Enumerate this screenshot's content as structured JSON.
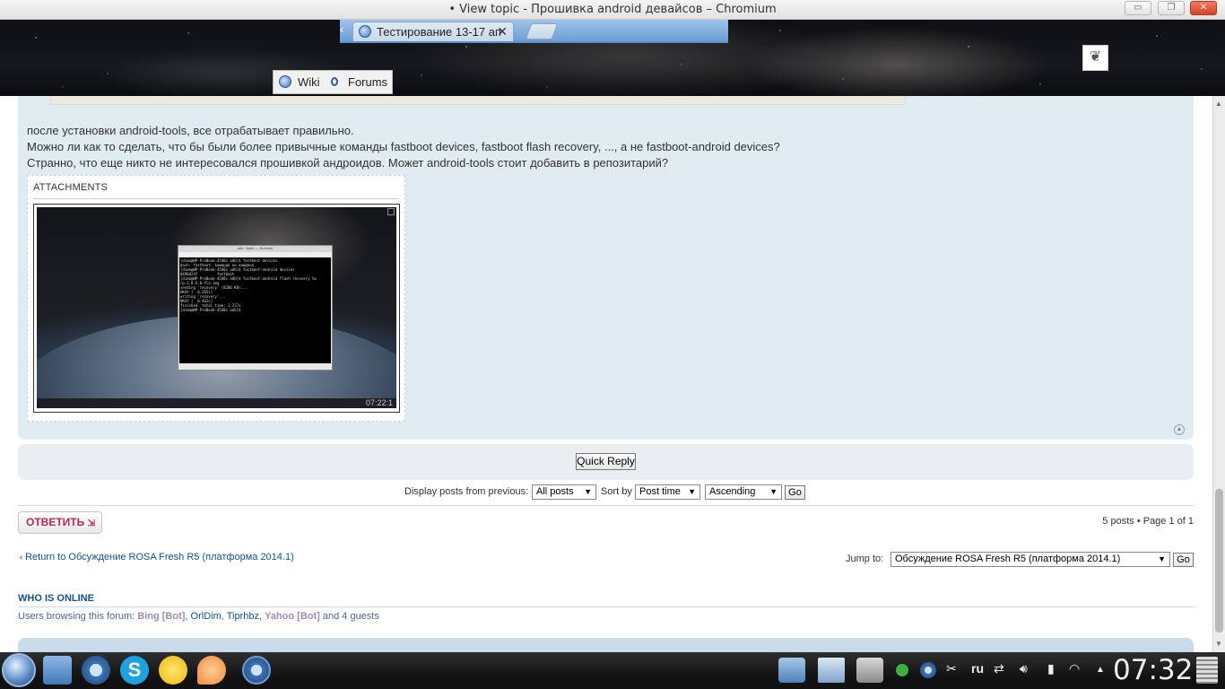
{
  "window": {
    "title": "• View topic - Прошивка android девайсов – Chromium",
    "minimize_label": "▭",
    "maximize_label": "❐",
    "close_label": "✕"
  },
  "browser": {
    "tab_label": "Тестирование 13-17 ап",
    "tab_close": "✕",
    "tab_scroll": "‹",
    "nav_wiki": "Wiki",
    "nav_forums": "Forums"
  },
  "post": {
    "lines": [
      "после установки android-tools, все отрабатывает правильно.",
      "Можно ли как то сделать, что бы были более привычные команды fastboot devices, fastboot flash recovery, ..., а не fastboot-android devices?",
      "Странно, что еще никто не интересовался прошивкой андроидов. Может android-tools стоит добавить в репозитарий?"
    ],
    "attachments_heading": "ATTACHMENTS",
    "screenshot_terminal": "[dima@HP-ProBook-4540s adb]$ fastboot devices\nbash: fastboot: команда не найдена\n[dima@HP-ProBook-4540s adb]$ fastboot-android devices\n0490d24f         fastboot\n[dima@HP-ProBook-4540s adb]$ fastboot-android flash recovery tw\nrp-2.8.6.0-flo.img\nsending 'recovery' (8206 KB)...\nOKAY [  0.265s]\nwriting 'recovery'...\nOKAY [  0.462s]\nfinished. total time: 1.227s\n[dima@HP-ProBook-4540s adb]$ ",
    "screenshot_title": "adb : bash — Konsole",
    "screenshot_clock": "07:22:1"
  },
  "controls": {
    "quick_reply": "Quick Reply",
    "display_label": "Display posts from previous:",
    "display_value": "All posts",
    "sort_label": "Sort by",
    "sort_value": "Post time",
    "order_value": "Ascending",
    "go": "Go"
  },
  "reply_button": "ОТВЕТИТЬ",
  "pagination": "5 posts • Page 1 of 1",
  "return_link": "Return to Обсуждение ROSA Fresh R5 (платформа 2014.1)",
  "jump": {
    "label": "Jump to:",
    "value": "Обсуждение ROSA Fresh R5 (платформа 2014.1)",
    "go": "Go"
  },
  "online": {
    "heading": "WHO IS ONLINE",
    "prefix": "Users browsing this forum: ",
    "users": [
      "Bing [Bot]",
      "OrlDim",
      "Tiprhbz",
      "Yahoo [Bot]"
    ],
    "suffix": " and 4 guests"
  },
  "taskbar": {
    "lang": "ru",
    "time": "07:32"
  },
  "colors": {
    "post_bg": "#e1ebf2",
    "link": "#105289",
    "reply_red": "#bc2a4d",
    "bot": "#9e8da7"
  }
}
